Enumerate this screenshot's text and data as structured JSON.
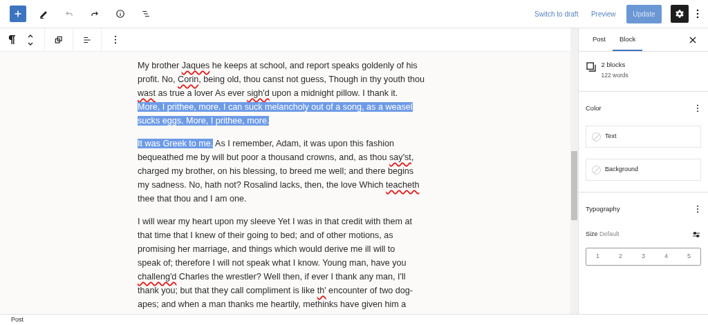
{
  "top_toolbar": {
    "tools": [
      {
        "kind": "add",
        "active": true,
        "disabled": false
      },
      {
        "kind": "edit",
        "active": false,
        "disabled": false
      },
      {
        "kind": "undo",
        "active": false,
        "disabled": true
      },
      {
        "kind": "redo",
        "active": false,
        "disabled": false
      },
      {
        "kind": "info",
        "active": false,
        "disabled": false
      },
      {
        "kind": "outline",
        "active": false,
        "disabled": false
      }
    ],
    "links": [
      "Switch to draft",
      "Preview"
    ],
    "update_button": {
      "label": "Update",
      "disabled": true
    },
    "settings_active": true
  },
  "paragraphs": [
    {
      "lines": [
        [
          {
            "text": "My brother "
          },
          {
            "text": "Jaques",
            "misspelled": true
          },
          {
            "text": " he keeps at school, and report speaks goldenly of his"
          }
        ],
        [
          {
            "text": "profit. No, "
          },
          {
            "text": "Corin",
            "misspelled": true
          },
          {
            "text": ", being old, thou canst not guess, Though in thy youth thou"
          }
        ],
        [
          {
            "text": "wast",
            "misspelled": true
          },
          {
            "text": " as true a lover As ever "
          },
          {
            "text": "sigh'd",
            "misspelled": true
          },
          {
            "text": " upon a midnight pillow. I thank it."
          }
        ],
        [
          {
            "text": "More, I prithee, more. I can suck melancholy out of a song, as a weasel",
            "selected": true
          }
        ],
        [
          {
            "text": "sucks eggs. More, I prithee, more.",
            "selected": true
          }
        ]
      ]
    },
    {
      "lines": [
        [
          {
            "text": "It was Greek to me.",
            "selected": true
          },
          {
            "text": " As I remember, Adam, it was upon this fashion"
          }
        ],
        [
          {
            "text": "bequeathed me by will but poor a thousand crowns, and, as thou "
          },
          {
            "text": "say'st",
            "misspelled": true
          },
          {
            "text": ","
          }
        ],
        [
          {
            "text": "charged my brother, on his blessing, to breed me well; and there begins"
          }
        ],
        [
          {
            "text": "my sadness. No, hath not? Rosalind lacks, then, the love Which "
          },
          {
            "text": "teacheth",
            "misspelled": true
          }
        ],
        [
          {
            "text": "thee that thou and I am one."
          }
        ]
      ]
    },
    {
      "lines": [
        [
          {
            "text": "I will wear my heart upon my sleeve Yet I was in that credit with them at"
          }
        ],
        [
          {
            "text": "that time that I knew of their going to bed; and of other motions, as"
          }
        ],
        [
          {
            "text": "promising her marriage, and things which would derive me ill will to"
          }
        ],
        [
          {
            "text": "speak of; therefore I will not speak what I know. Young man, have you"
          }
        ],
        [
          {
            "text": "challeng'd",
            "misspelled": true
          },
          {
            "text": " Charles the wrestler? Well then, if ever I thank any man, I'll"
          }
        ],
        [
          {
            "text": "thank you; but that they call compliment is like "
          },
          {
            "text": "th'",
            "misspelled": true
          },
          {
            "text": " encounter of two dog-"
          }
        ],
        [
          {
            "text": "apes; and when a man thanks me heartily, methinks have given him a"
          }
        ]
      ]
    }
  ],
  "sidebar": {
    "tabs": [
      {
        "label": "Post",
        "selected": false
      },
      {
        "label": "Block",
        "selected": true
      }
    ],
    "block_card": {
      "title": "2 blocks",
      "subtitle": "122 words"
    },
    "color": {
      "title": "Color",
      "options": [
        "Text",
        "Background"
      ]
    },
    "typography": {
      "title": "Typography",
      "size_label": "Size",
      "size_value": "Default",
      "sizes": [
        {
          "label": "1",
          "selected": false
        },
        {
          "label": "2",
          "selected": false
        },
        {
          "label": "3",
          "selected": false
        },
        {
          "label": "4",
          "selected": false
        },
        {
          "label": "5",
          "selected": false
        }
      ]
    }
  },
  "status_bar": "Post"
}
